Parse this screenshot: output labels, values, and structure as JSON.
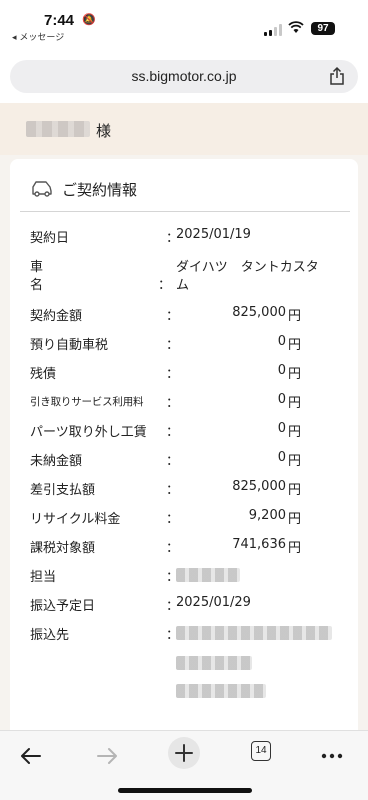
{
  "status_bar": {
    "time": "7:44",
    "back_app": "◂ メッセージ",
    "battery": "97"
  },
  "browser": {
    "url": "ss.bigmotor.co.jp",
    "tab_count": "14"
  },
  "greeting": {
    "suffix": "様"
  },
  "contract": {
    "title": "ご契約情報",
    "colon": "：",
    "yen": "円",
    "contract_date": {
      "label": "契約日",
      "value": "2025/01/19"
    },
    "car_name": {
      "label_line1": "車",
      "label_line2": "名",
      "value_line1": "ダイハツ　タントカスタ",
      "value_line2": "ム"
    },
    "contract_amount": {
      "label": "契約金額",
      "value": "825,000"
    },
    "deposit_tax": {
      "label": "預り自動車税",
      "value": "0"
    },
    "remaining_debt": {
      "label": "残債",
      "value": "0"
    },
    "pickup_fee": {
      "label": "引き取りサービス利用料",
      "value": "0"
    },
    "parts_removal": {
      "label": "パーツ取り外し工賃",
      "value": "0"
    },
    "unpaid": {
      "label": "未納金額",
      "value": "0"
    },
    "net_payment": {
      "label": "差引支払額",
      "value": "825,000"
    },
    "recycle_fee": {
      "label": "リサイクル料金",
      "value": "9,200"
    },
    "taxable_amount": {
      "label": "課税対象額",
      "value": "741,636"
    },
    "staff": {
      "label": "担当"
    },
    "transfer_date": {
      "label": "振込予定日",
      "value": "2025/01/29"
    },
    "transfer_to": {
      "label": "振込先"
    }
  }
}
